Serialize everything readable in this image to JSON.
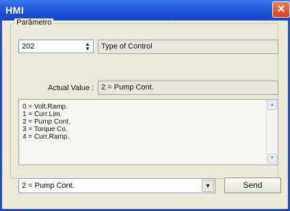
{
  "window": {
    "title": "HMI",
    "close_label": "✕"
  },
  "group": {
    "label": "Parâmetro"
  },
  "parameter": {
    "number": "202",
    "name": "Type of Control"
  },
  "actual": {
    "label": "Actual Value :",
    "value": "2 = Pump Cont."
  },
  "options": [
    "0 = Volt.Ramp.",
    "1 = Curr.Lim.",
    "2 = Pump Cont.",
    "3 = Torque Co.",
    "4 = Curr.Ramp."
  ],
  "select": {
    "value": "2 = Pump Cont."
  },
  "send": {
    "label": "Send"
  }
}
